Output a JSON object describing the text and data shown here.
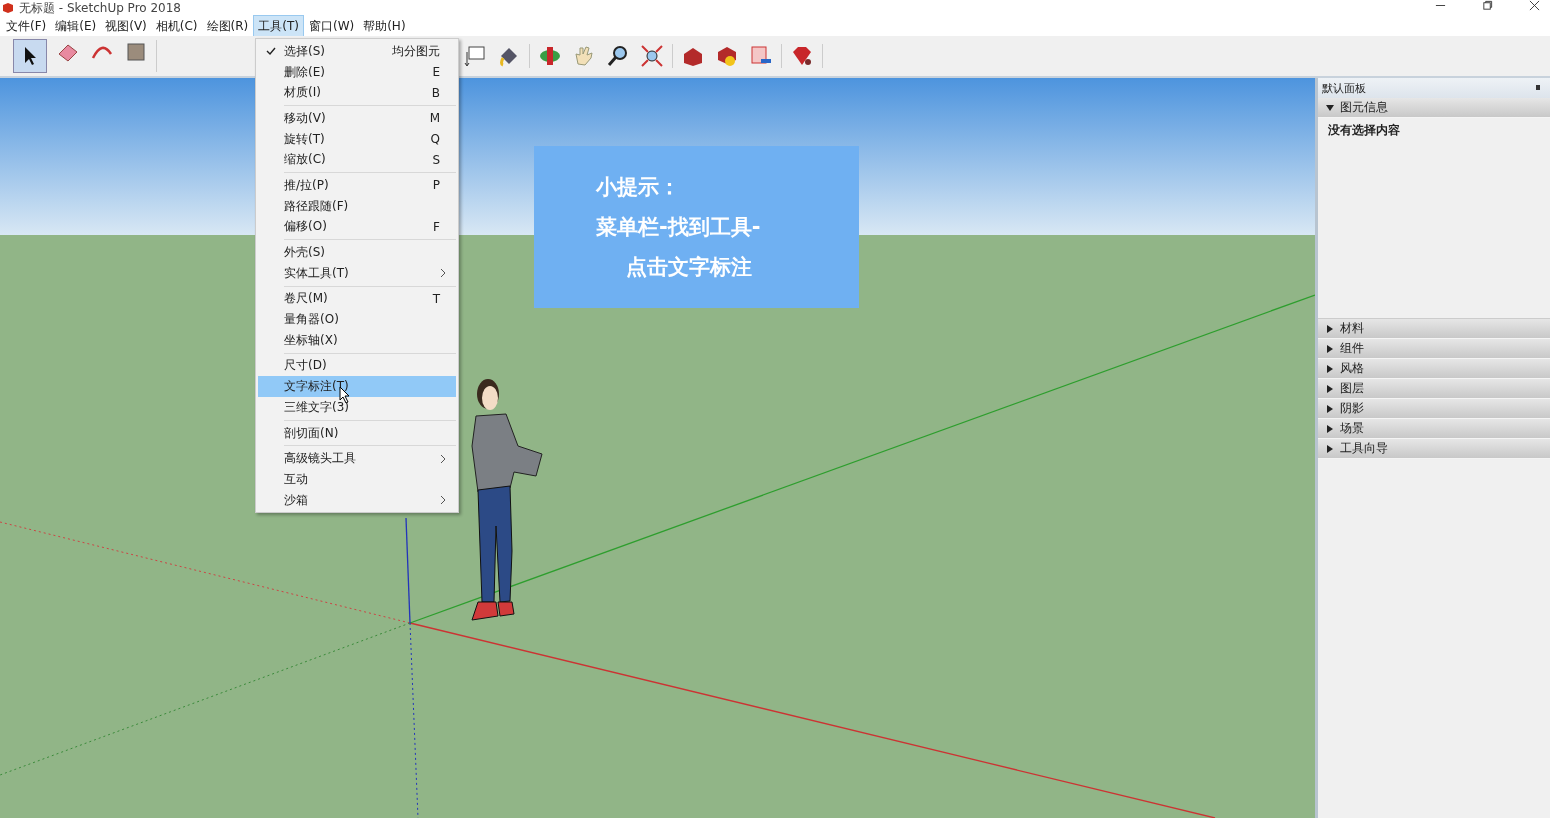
{
  "window": {
    "title": "无标题 - SketchUp Pro 2018"
  },
  "menubar": [
    {
      "label": "文件(F)",
      "selected": false
    },
    {
      "label": "编辑(E)",
      "selected": false
    },
    {
      "label": "视图(V)",
      "selected": false
    },
    {
      "label": "相机(C)",
      "selected": false
    },
    {
      "label": "绘图(R)",
      "selected": false
    },
    {
      "label": "工具(T)",
      "selected": true
    },
    {
      "label": "窗口(W)",
      "selected": false
    },
    {
      "label": "帮助(H)",
      "selected": false
    }
  ],
  "menu": [
    {
      "kind": "item",
      "label": "选择(S)",
      "shortcut": "均分图元",
      "checked": true,
      "selected": false,
      "submenu": false
    },
    {
      "kind": "item",
      "label": "删除(E)",
      "shortcut": "E",
      "checked": false,
      "selected": false,
      "submenu": false
    },
    {
      "kind": "item",
      "label": "材质(I)",
      "shortcut": "B",
      "checked": false,
      "selected": false,
      "submenu": false
    },
    {
      "kind": "separator"
    },
    {
      "kind": "item",
      "label": "移动(V)",
      "shortcut": "M",
      "checked": false,
      "selected": false,
      "submenu": false
    },
    {
      "kind": "item",
      "label": "旋转(T)",
      "shortcut": "Q",
      "checked": false,
      "selected": false,
      "submenu": false
    },
    {
      "kind": "item",
      "label": "缩放(C)",
      "shortcut": "S",
      "checked": false,
      "selected": false,
      "submenu": false
    },
    {
      "kind": "separator"
    },
    {
      "kind": "item",
      "label": "推/拉(P)",
      "shortcut": "P",
      "checked": false,
      "selected": false,
      "submenu": false
    },
    {
      "kind": "item",
      "label": "路径跟随(F)",
      "checked": false,
      "selected": false,
      "submenu": false
    },
    {
      "kind": "item",
      "label": "偏移(O)",
      "shortcut": "F",
      "checked": false,
      "selected": false,
      "submenu": false
    },
    {
      "kind": "separator"
    },
    {
      "kind": "item",
      "label": "外壳(S)",
      "checked": false,
      "selected": false,
      "submenu": false
    },
    {
      "kind": "item",
      "label": "实体工具(T)",
      "checked": false,
      "selected": false,
      "submenu": true
    },
    {
      "kind": "separator"
    },
    {
      "kind": "item",
      "label": "卷尺(M)",
      "shortcut": "T",
      "checked": false,
      "selected": false,
      "submenu": false
    },
    {
      "kind": "item",
      "label": "量角器(O)",
      "checked": false,
      "selected": false,
      "submenu": false
    },
    {
      "kind": "item",
      "label": "坐标轴(X)",
      "checked": false,
      "selected": false,
      "submenu": false
    },
    {
      "kind": "separator"
    },
    {
      "kind": "item",
      "label": "尺寸(D)",
      "checked": false,
      "selected": false,
      "submenu": false
    },
    {
      "kind": "item",
      "label": "文字标注(T)",
      "checked": false,
      "selected": true,
      "submenu": false
    },
    {
      "kind": "item",
      "label": "三维文字(3)",
      "checked": false,
      "selected": false,
      "submenu": false
    },
    {
      "kind": "separator"
    },
    {
      "kind": "item",
      "label": "剖切面(N)",
      "checked": false,
      "selected": false,
      "submenu": false
    },
    {
      "kind": "separator"
    },
    {
      "kind": "item",
      "label": "高级镜头工具",
      "checked": false,
      "selected": false,
      "submenu": true
    },
    {
      "kind": "item",
      "label": "互动",
      "checked": false,
      "selected": false,
      "submenu": false
    },
    {
      "kind": "item",
      "label": "沙箱",
      "checked": false,
      "selected": false,
      "submenu": true
    }
  ],
  "tip": {
    "title": "小提示：",
    "lines": [
      "菜单栏-找到工具-",
      "点击文字标注"
    ]
  },
  "panel": {
    "title": "默认面板",
    "sections": [
      {
        "label": "图元信息",
        "expanded": true,
        "content": "没有选择内容"
      },
      {
        "label": "材料",
        "expanded": false
      },
      {
        "label": "组件",
        "expanded": false
      },
      {
        "label": "风格",
        "expanded": false
      },
      {
        "label": "图层",
        "expanded": false
      },
      {
        "label": "阴影",
        "expanded": false
      },
      {
        "label": "场景",
        "expanded": false
      },
      {
        "label": "工具向导",
        "expanded": false
      }
    ]
  }
}
